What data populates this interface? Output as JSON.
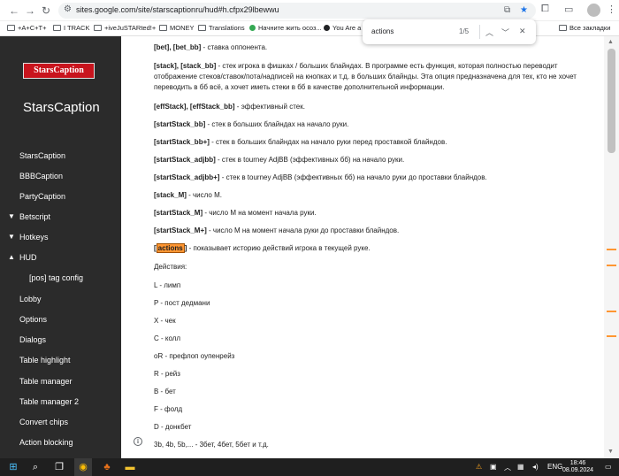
{
  "browser": {
    "url": "sites.google.com/site/starscaptionru/hud#h.cfpx29lbewwu",
    "bookmarks": [
      "+A+C+T+",
      "I TRACK",
      "+iveJuSTARted!+",
      "MONEY",
      "Translations",
      "Начните жить осоз...",
      "You Are a P",
      "Все закладки"
    ],
    "find": {
      "query": "actions",
      "count": "1/5"
    }
  },
  "sidebar": {
    "logo": "StarsCaption",
    "site_name": "StarsCaption",
    "items": [
      {
        "label": "StarsCaption"
      },
      {
        "label": "BBBCaption"
      },
      {
        "label": "PartyCaption"
      },
      {
        "label": "Betscript",
        "chevron": "chevron-down"
      },
      {
        "label": "Hotkeys",
        "chevron": "chevron-down"
      },
      {
        "label": "HUD",
        "chevron": "chevron-up"
      },
      {
        "label": "[pos] tag config"
      },
      {
        "label": "Lobby"
      },
      {
        "label": "Options"
      },
      {
        "label": "Dialogs"
      },
      {
        "label": "Table highlight"
      },
      {
        "label": "Table manager"
      },
      {
        "label": "Table manager 2"
      },
      {
        "label": "Convert chips"
      },
      {
        "label": "Action blocking"
      }
    ]
  },
  "content": {
    "lines": [
      {
        "tag": "[bet], [bet_bb]",
        "text": " - ставка оппонента."
      },
      {
        "tag": "[stack], [stack_bb]",
        "text": " - стек игрока в фишках / больших блайндах. В программе есть функция, которая полностью переводит"
      },
      {
        "tag": "",
        "text": "отображение стеков/ставок/пота/надписей на кнопках и т.д. в больших блайнды. Эта опция предназначена для тех, кто не хочет"
      },
      {
        "tag": "",
        "text": "переводить в бб всё, а хочет иметь стеки в бб в качестве дополнительной информации."
      },
      {
        "tag": "[effStack], [effStack_bb]",
        "text": " - эффективный стек."
      },
      {
        "tag": "[startStack_bb]",
        "text": " - стек в больших блайндах на начало руки."
      },
      {
        "tag": "[startStack_bb+]",
        "text": " - стек в больших блайндах на начало руки перед проставкой блайндов."
      },
      {
        "tag": "[startStack_adjbb]",
        "text": " - стек в tourney AdjBB (эффективных бб) на начало руки."
      },
      {
        "tag": "[startStack_adjbb+]",
        "text": " - стек в tourney AdjBB (эффективных бб) на начало руки до проставки блайндов."
      },
      {
        "tag": "[stack_M]",
        "text": " - число M."
      },
      {
        "tag": "[startStack_M]",
        "text": " - число M на момент начала руки."
      },
      {
        "tag": "[startStack_M+]",
        "text": " - число M на момент начала руки до проставки блайндов."
      }
    ],
    "actions_line": {
      "open": "[",
      "word": "actions",
      "close": "]",
      "text": " - показывает историю действий игрока в текущей руке."
    },
    "list": [
      "Действия:",
      "L - лимп",
      "P - пост дедмани",
      "X - чек",
      "C - колл",
      "oR - префлоп оупенрейз",
      "R - рейз",
      "B - бет",
      "F - фолд",
      "D - донкбет",
      "3b, 4b, 5b,... - 3бет, 4бет, 5бет и т.д."
    ]
  },
  "taskbar": {
    "lang": "ENG",
    "time": "18:46",
    "date": "08.09.2024"
  },
  "colors": {
    "sidebar_bg": "#2b2b2b",
    "logo_red": "#c8141d",
    "find_highlight": "#ff9632"
  }
}
